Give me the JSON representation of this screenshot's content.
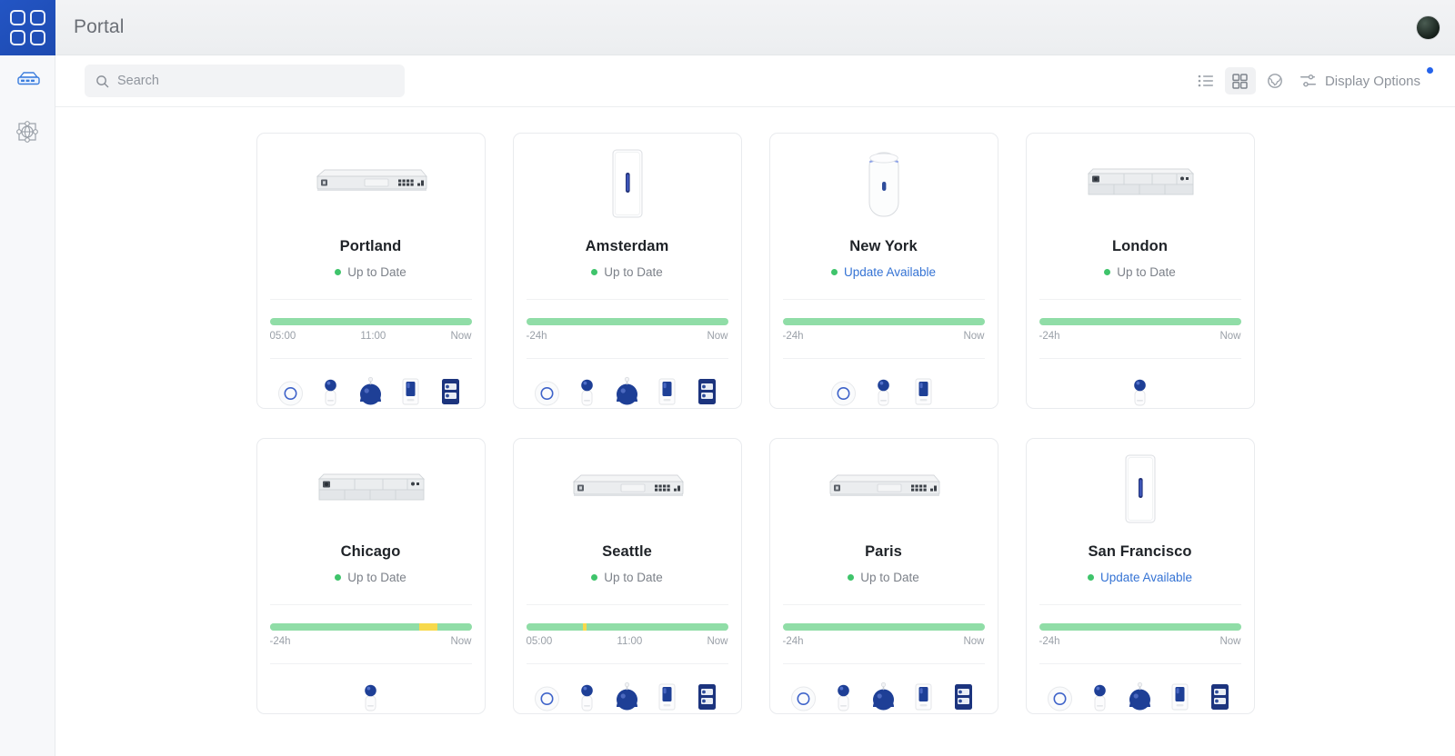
{
  "sidebar": {
    "logo": {
      "name": "portal-logo",
      "icon": "grid-logo-icon"
    },
    "items": [
      {
        "icon": "network-device-icon",
        "name": "sidebar-item-network",
        "active": true
      },
      {
        "icon": "topology-globe-icon",
        "name": "sidebar-item-topology",
        "active": false
      }
    ]
  },
  "header": {
    "title": "Portal",
    "avatar_icon": "user-avatar"
  },
  "search": {
    "placeholder": "Search",
    "value": "",
    "icon": "search-icon"
  },
  "toolbar": {
    "views": [
      {
        "icon": "list-view-icon",
        "name": "view-list",
        "active": false
      },
      {
        "icon": "grid-view-icon",
        "name": "view-grid",
        "active": true
      },
      {
        "icon": "map-globe-icon",
        "name": "view-map",
        "active": false
      }
    ],
    "display_options": {
      "label": "Display Options",
      "icon": "sliders-icon",
      "has_notification": true,
      "notification_color": "#2563eb"
    }
  },
  "colors": {
    "bar_green": "#90dda7",
    "bar_yellow": "#f7d94c",
    "status_green": "#3fc46b",
    "link_blue": "#3573d4",
    "brand_blue": "#2355c4"
  },
  "sites": [
    {
      "name": "Portland",
      "hero_icon": "rack-gateway-icon",
      "status": {
        "text": "Up to Date",
        "is_link": false
      },
      "timeline": {
        "segments": [
          {
            "color": "#90dda7",
            "pct": 100
          }
        ],
        "labels": [
          "05:00",
          "11:00",
          "Now"
        ]
      },
      "devices": [
        "access-point-icon",
        "camera-stand-icon",
        "dome-camera-icon",
        "doorbell-icon",
        "door-reader-icon"
      ]
    },
    {
      "name": "Amsterdam",
      "hero_icon": "wall-access-point-icon",
      "status": {
        "text": "Up to Date",
        "is_link": false
      },
      "timeline": {
        "segments": [
          {
            "color": "#90dda7",
            "pct": 100
          }
        ],
        "labels": [
          "-24h",
          "Now"
        ]
      },
      "devices": [
        "access-point-icon",
        "camera-stand-icon",
        "dome-camera-icon",
        "doorbell-icon",
        "door-reader-icon"
      ]
    },
    {
      "name": "New York",
      "hero_icon": "cylinder-gateway-icon",
      "status": {
        "text": "Update Available",
        "is_link": true
      },
      "timeline": {
        "segments": [
          {
            "color": "#90dda7",
            "pct": 100
          }
        ],
        "labels": [
          "-24h",
          "Now"
        ]
      },
      "devices": [
        "access-point-icon",
        "camera-stand-icon",
        "doorbell-icon"
      ]
    },
    {
      "name": "London",
      "hero_icon": "rack-chassis-icon",
      "status": {
        "text": "Up to Date",
        "is_link": false
      },
      "timeline": {
        "segments": [
          {
            "color": "#90dda7",
            "pct": 100
          }
        ],
        "labels": [
          "-24h",
          "Now"
        ]
      },
      "devices": [
        "camera-stand-icon"
      ]
    },
    {
      "name": "Chicago",
      "hero_icon": "rack-chassis-icon",
      "status": {
        "text": "Up to Date",
        "is_link": false
      },
      "timeline": {
        "segments": [
          {
            "color": "#90dda7",
            "pct": 74
          },
          {
            "color": "#f7d94c",
            "pct": 9
          },
          {
            "color": "#90dda7",
            "pct": 17
          }
        ],
        "labels": [
          "-24h",
          "Now"
        ]
      },
      "devices": [
        "camera-stand-icon"
      ]
    },
    {
      "name": "Seattle",
      "hero_icon": "rack-gateway-icon",
      "status": {
        "text": "Up to Date",
        "is_link": false
      },
      "timeline": {
        "segments": [
          {
            "color": "#90dda7",
            "pct": 28
          },
          {
            "color": "#f7d94c",
            "pct": 2
          },
          {
            "color": "#90dda7",
            "pct": 70
          }
        ],
        "labels": [
          "05:00",
          "11:00",
          "Now"
        ]
      },
      "devices": [
        "access-point-icon",
        "camera-stand-icon",
        "dome-camera-icon",
        "doorbell-icon",
        "door-reader-icon"
      ]
    },
    {
      "name": "Paris",
      "hero_icon": "rack-gateway-icon",
      "status": {
        "text": "Up to Date",
        "is_link": false
      },
      "timeline": {
        "segments": [
          {
            "color": "#90dda7",
            "pct": 100
          }
        ],
        "labels": [
          "-24h",
          "Now"
        ]
      },
      "devices": [
        "access-point-icon",
        "camera-stand-icon",
        "dome-camera-icon",
        "doorbell-icon",
        "door-reader-icon"
      ]
    },
    {
      "name": "San Francisco",
      "hero_icon": "wall-access-point-icon",
      "status": {
        "text": "Update Available",
        "is_link": true
      },
      "timeline": {
        "segments": [
          {
            "color": "#90dda7",
            "pct": 100
          }
        ],
        "labels": [
          "-24h",
          "Now"
        ]
      },
      "devices": [
        "access-point-icon",
        "camera-stand-icon",
        "dome-camera-icon",
        "doorbell-icon",
        "door-reader-icon"
      ]
    }
  ]
}
